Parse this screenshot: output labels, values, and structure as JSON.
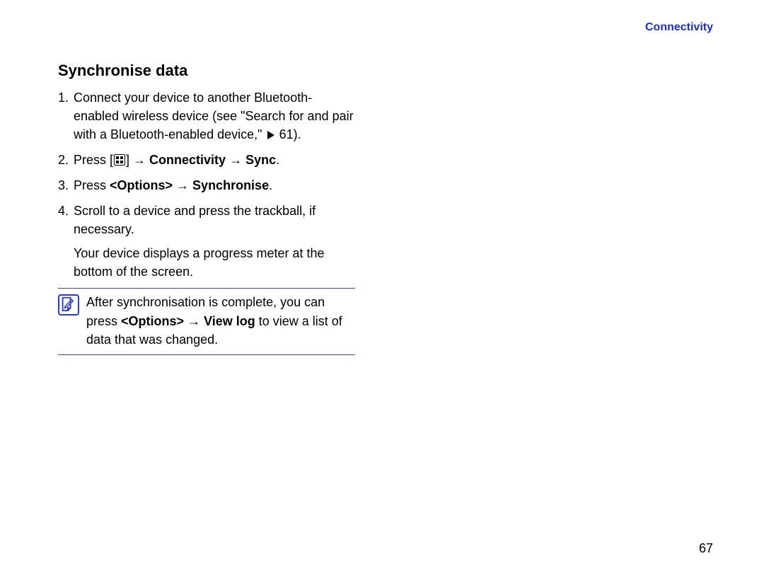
{
  "header": {
    "breadcrumb": "Connectivity"
  },
  "heading": "Synchronise data",
  "steps": [
    {
      "num": "1.",
      "text_before": "Connect your device to another Bluetooth-enabled wireless device (see \"Search for and pair with a Bluetooth-enabled device,\" ",
      "xref": "61",
      "text_after": ")."
    },
    {
      "num": "2.",
      "prefix": "Press [",
      "after_icon": "] → ",
      "bold1": "Connectivity",
      "mid": " → ",
      "bold2": "Sync",
      "suffix": "."
    },
    {
      "num": "3.",
      "prefix": "Press ",
      "bold1": "<Options>",
      "mid": " → ",
      "bold2": "Synchronise",
      "suffix": "."
    },
    {
      "num": "4.",
      "line1": "Scroll to a device and press the trackball, if necessary.",
      "line2": "Your device displays a progress meter at the bottom of the screen."
    }
  ],
  "note": {
    "t1": "After synchronisation is complete, you can press ",
    "b1": "<Options>",
    "t2": " → ",
    "b2": "View log",
    "t3": " to view a list of data that was changed."
  },
  "page_number": "67"
}
